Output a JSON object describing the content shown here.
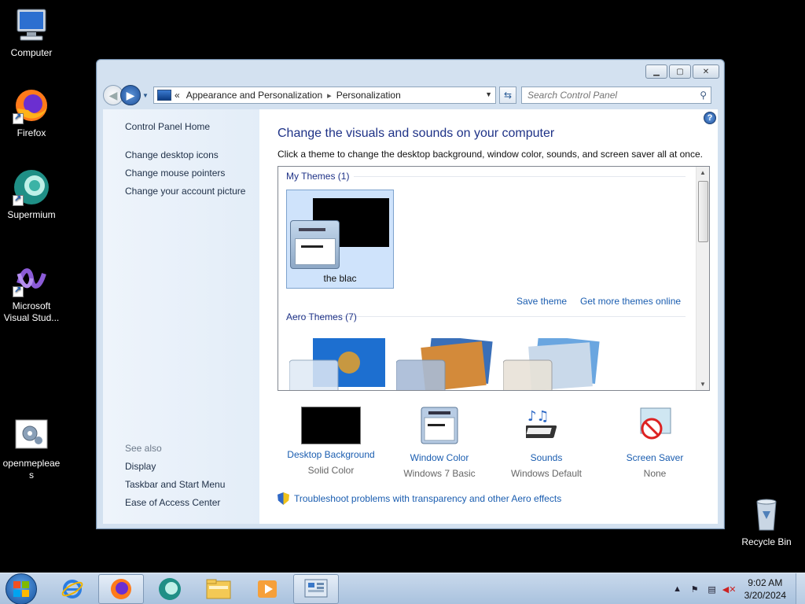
{
  "desktop": {
    "icons": [
      {
        "label": "Computer",
        "icon": "computer-icon"
      },
      {
        "label": "Firefox",
        "icon": "firefox-icon"
      },
      {
        "label": "Supermium",
        "icon": "supermium-icon"
      },
      {
        "label": "Microsoft Visual Stud...",
        "icon": "visual-studio-icon"
      },
      {
        "label": "openmepleaes",
        "icon": "gear-document-icon"
      },
      {
        "label": "Recycle Bin",
        "icon": "recycle-bin-icon"
      }
    ]
  },
  "window": {
    "controls": {
      "minimize": "▁",
      "maximize": "▢",
      "close": "✕"
    },
    "address": {
      "chevron": "«",
      "crumbs": [
        "Appearance and Personalization",
        "Personalization"
      ],
      "separator": "▸"
    },
    "search": {
      "placeholder": "Search Control Panel"
    },
    "sidebar": {
      "home": "Control Panel Home",
      "links": [
        "Change desktop icons",
        "Change mouse pointers",
        "Change your account picture"
      ],
      "see_also": "See also",
      "see_also_links": [
        "Display",
        "Taskbar and Start Menu",
        "Ease of Access Center"
      ]
    },
    "main": {
      "heading": "Change the visuals and sounds on your computer",
      "subheading": "Click a theme to change the desktop background, window color, sounds, and screen saver all at once.",
      "my_themes_label": "My Themes (1)",
      "selected_theme": "the blac",
      "save_theme": "Save theme",
      "get_more": "Get more themes online",
      "aero_label": "Aero Themes (7)",
      "settings": [
        {
          "label": "Desktop Background",
          "value": "Solid Color",
          "icon": "desktop-background-icon"
        },
        {
          "label": "Window Color",
          "value": "Windows 7 Basic",
          "icon": "window-color-icon"
        },
        {
          "label": "Sounds",
          "value": "Windows Default",
          "icon": "sounds-icon"
        },
        {
          "label": "Screen Saver",
          "value": "None",
          "icon": "screen-saver-icon"
        }
      ],
      "troubleshoot": "Troubleshoot problems with transparency and other Aero effects"
    }
  },
  "taskbar": {
    "time": "9:02 AM",
    "date": "3/20/2024",
    "colors": {
      "bar": "#b9cde4",
      "accent": "#1a5db0",
      "heading": "#1e3287"
    }
  }
}
